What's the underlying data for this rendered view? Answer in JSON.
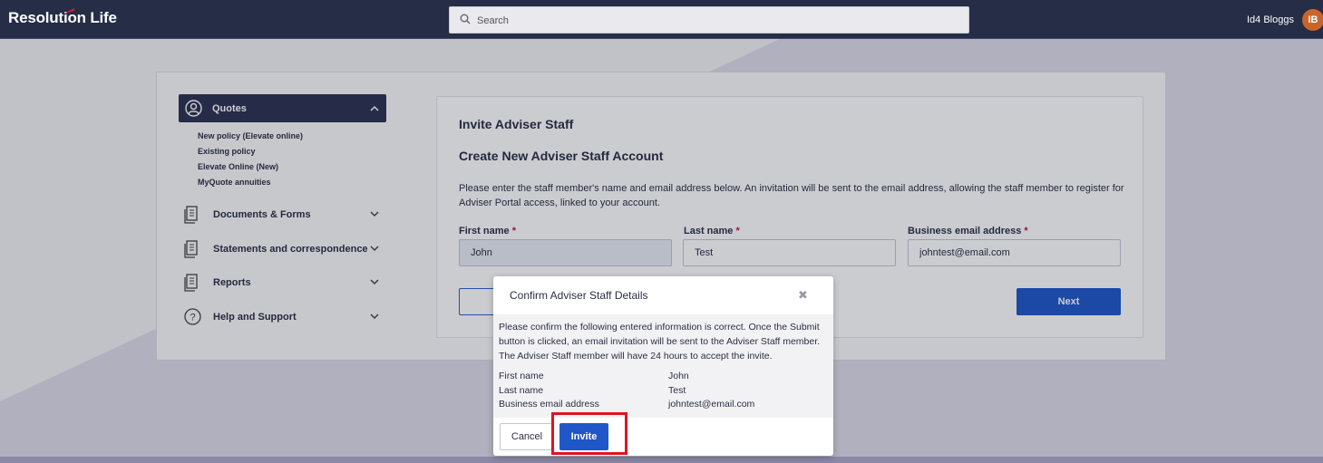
{
  "header": {
    "logo_text": "Resolution Life",
    "search_placeholder": "Search",
    "user_name": "Id4 Bloggs",
    "user_initials": "IB"
  },
  "sidebar": {
    "quotes_label": "Quotes",
    "quotes_items": [
      "New policy (Elevate online)",
      "Existing policy",
      "Elevate Online (New)",
      "MyQuote annuities"
    ],
    "nav_items": [
      {
        "label": "Documents & Forms",
        "icon": "document-icon"
      },
      {
        "label": "Statements and correspondence",
        "icon": "document-icon"
      },
      {
        "label": "Reports",
        "icon": "document-icon"
      },
      {
        "label": "Help and Support",
        "icon": "help-icon"
      }
    ]
  },
  "form": {
    "heading": "Invite Adviser Staff",
    "subheading": "Create New Adviser Staff Account",
    "description": "Please enter the staff member's name and email address below. An invitation will be sent to the email address, allowing the staff member to register for Adviser Portal access, linked to your account.",
    "first_name_label": "First name",
    "last_name_label": "Last name",
    "email_label": "Business email address",
    "required_mark": "*",
    "first_name_value": "John",
    "last_name_value": "Test",
    "email_value": "johntest@email.com",
    "next_label": "Next"
  },
  "modal": {
    "title": "Confirm Adviser Staff Details",
    "close_glyph": "✖",
    "message": "Please confirm the following entered information is correct. Once the Submit button is clicked, an email invitation will be sent to the Adviser Staff member. The Adviser Staff member will have 24 hours to accept the invite.",
    "rows": [
      {
        "key": "First name",
        "value": "John"
      },
      {
        "key": "Last name",
        "value": "Test"
      },
      {
        "key": "Business email address",
        "value": "johntest@email.com"
      }
    ],
    "cancel_label": "Cancel",
    "invite_label": "Invite"
  },
  "colors": {
    "navy": "#252d47",
    "primary_blue": "#1f57c9",
    "highlight_red": "#e01322",
    "avatar_orange": "#c9652a"
  }
}
